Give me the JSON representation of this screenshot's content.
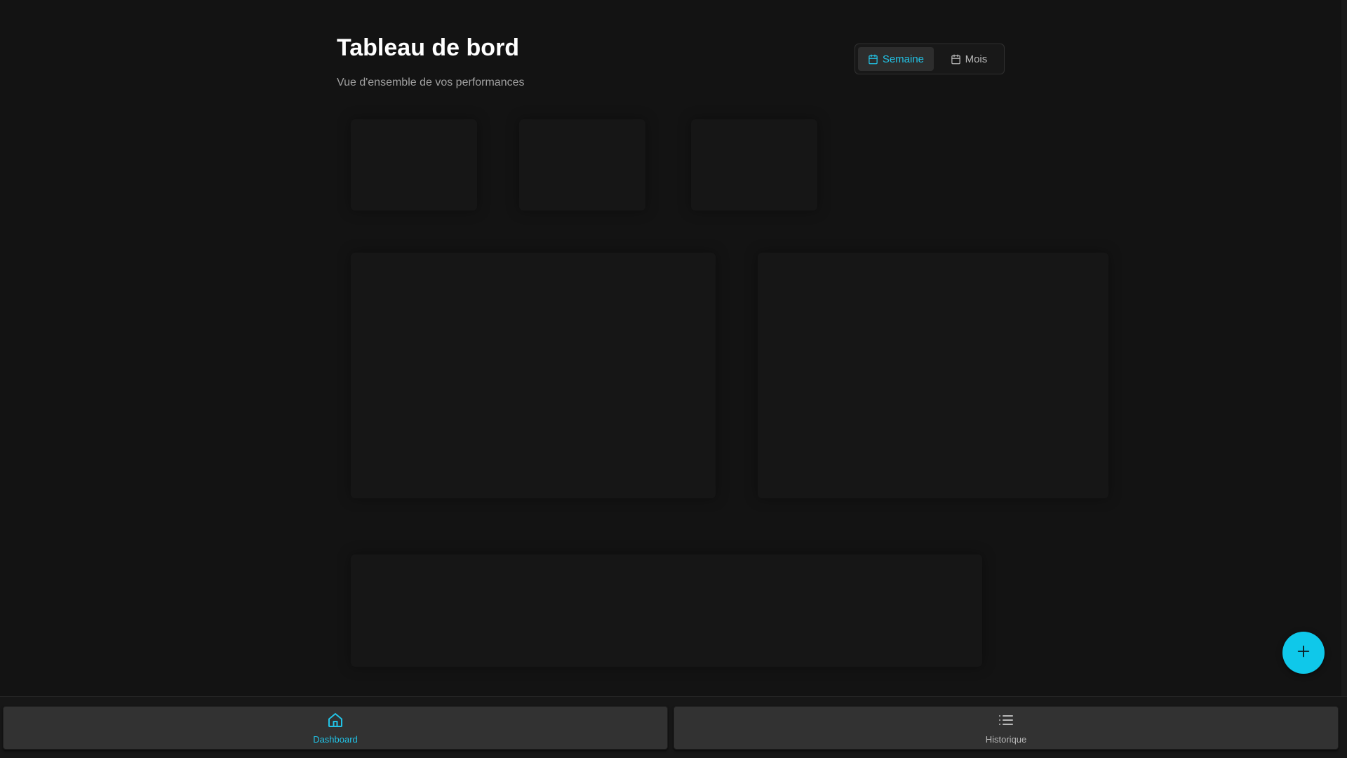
{
  "header": {
    "title": "Tableau de bord",
    "subtitle": "Vue d'ensemble de vos performances"
  },
  "period_toggle": {
    "options": [
      {
        "label": "Semaine",
        "icon": "calendar-icon",
        "active": true
      },
      {
        "label": "Mois",
        "icon": "calendar-icon",
        "active": false
      }
    ]
  },
  "fab": {
    "icon": "plus-icon"
  },
  "bottom_nav": {
    "items": [
      {
        "label": "Dashboard",
        "icon": "home-icon",
        "active": true
      },
      {
        "label": "Historique",
        "icon": "list-icon",
        "active": false
      }
    ]
  },
  "colors": {
    "background": "#131313",
    "accent": "#22c3e6",
    "fab": "#0fc8ea",
    "title": "#ffffff",
    "muted_text": "#a0a0a0",
    "nav_button": "#323232"
  }
}
